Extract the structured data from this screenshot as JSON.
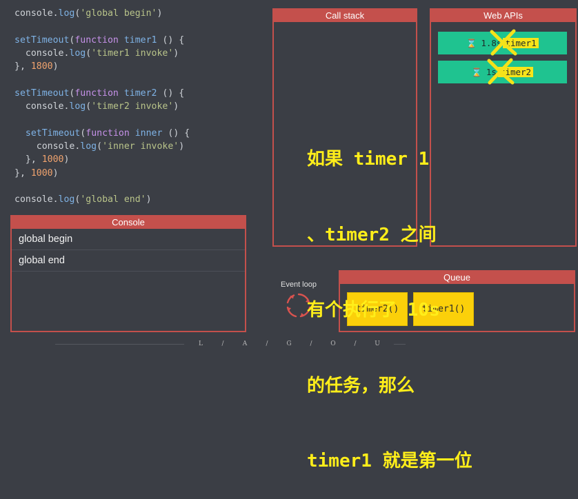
{
  "code": {
    "lines": [
      [
        [
          "obj",
          "console"
        ],
        [
          "punc",
          "."
        ],
        [
          "fn",
          "log"
        ],
        [
          "punc",
          "("
        ],
        [
          "str",
          "'global begin'"
        ],
        [
          "punc",
          ")"
        ]
      ],
      [],
      [
        [
          "fn",
          "setTimeout"
        ],
        [
          "punc",
          "("
        ],
        [
          "kw",
          "function"
        ],
        [
          "punc",
          " "
        ],
        [
          "fn",
          "timer1"
        ],
        [
          "punc",
          " () {"
        ]
      ],
      [
        [
          "punc",
          "  "
        ],
        [
          "obj",
          "console"
        ],
        [
          "punc",
          "."
        ],
        [
          "fn",
          "log"
        ],
        [
          "punc",
          "("
        ],
        [
          "str",
          "'timer1 invoke'"
        ],
        [
          "punc",
          ")"
        ]
      ],
      [
        [
          "punc",
          "}, "
        ],
        [
          "num",
          "1800"
        ],
        [
          "punc",
          ")"
        ]
      ],
      [],
      [
        [
          "fn",
          "setTimeout"
        ],
        [
          "punc",
          "("
        ],
        [
          "kw",
          "function"
        ],
        [
          "punc",
          " "
        ],
        [
          "fn",
          "timer2"
        ],
        [
          "punc",
          " () {"
        ]
      ],
      [
        [
          "punc",
          "  "
        ],
        [
          "obj",
          "console"
        ],
        [
          "punc",
          "."
        ],
        [
          "fn",
          "log"
        ],
        [
          "punc",
          "("
        ],
        [
          "str",
          "'timer2 invoke'"
        ],
        [
          "punc",
          ")"
        ]
      ],
      [],
      [
        [
          "punc",
          "  "
        ],
        [
          "fn",
          "setTimeout"
        ],
        [
          "punc",
          "("
        ],
        [
          "kw",
          "function"
        ],
        [
          "punc",
          " "
        ],
        [
          "fn",
          "inner"
        ],
        [
          "punc",
          " () {"
        ]
      ],
      [
        [
          "punc",
          "    "
        ],
        [
          "obj",
          "console"
        ],
        [
          "punc",
          "."
        ],
        [
          "fn",
          "log"
        ],
        [
          "punc",
          "("
        ],
        [
          "str",
          "'inner invoke'"
        ],
        [
          "punc",
          ")"
        ]
      ],
      [
        [
          "punc",
          "  }, "
        ],
        [
          "num",
          "1000"
        ],
        [
          "punc",
          ")"
        ]
      ],
      [
        [
          "punc",
          "}, "
        ],
        [
          "num",
          "1000"
        ],
        [
          "punc",
          ")"
        ]
      ],
      [],
      [
        [
          "obj",
          "console"
        ],
        [
          "punc",
          "."
        ],
        [
          "fn",
          "log"
        ],
        [
          "punc",
          "("
        ],
        [
          "str",
          "'global end'"
        ],
        [
          "punc",
          ")"
        ]
      ]
    ]
  },
  "console": {
    "title": "Console",
    "lines": [
      "global begin",
      "global end"
    ]
  },
  "callstack": {
    "title": "Call stack"
  },
  "webapis": {
    "title": "Web APIs",
    "timers": [
      {
        "icon": "hourglass-icon",
        "glyph": "⌛",
        "remaining": "1.8s",
        "name": "timer1"
      },
      {
        "icon": "hourglass-icon",
        "glyph": "⌛",
        "remaining": "1s",
        "name": "timer2"
      }
    ]
  },
  "queue": {
    "title": "Queue",
    "items": [
      "timer2()",
      "timer1()"
    ]
  },
  "event_loop": {
    "label": "Event loop"
  },
  "overlay": {
    "lines": [
      "如果 timer 1",
      "、timer2 之间",
      "有个执行了 10s",
      "的任务，那么",
      "timer1 就是第一位"
    ]
  },
  "footer": {
    "letters": [
      "L",
      "/",
      "A",
      "/",
      "G",
      "/",
      "O",
      "/",
      "U"
    ]
  },
  "colors": {
    "background": "#3b3e45",
    "panel_border": "#c4504c",
    "timer_green": "#1fc390",
    "queue_yellow": "#fbd00a",
    "overlay_text": "#ffee1a",
    "cross": "#f5e21a"
  }
}
